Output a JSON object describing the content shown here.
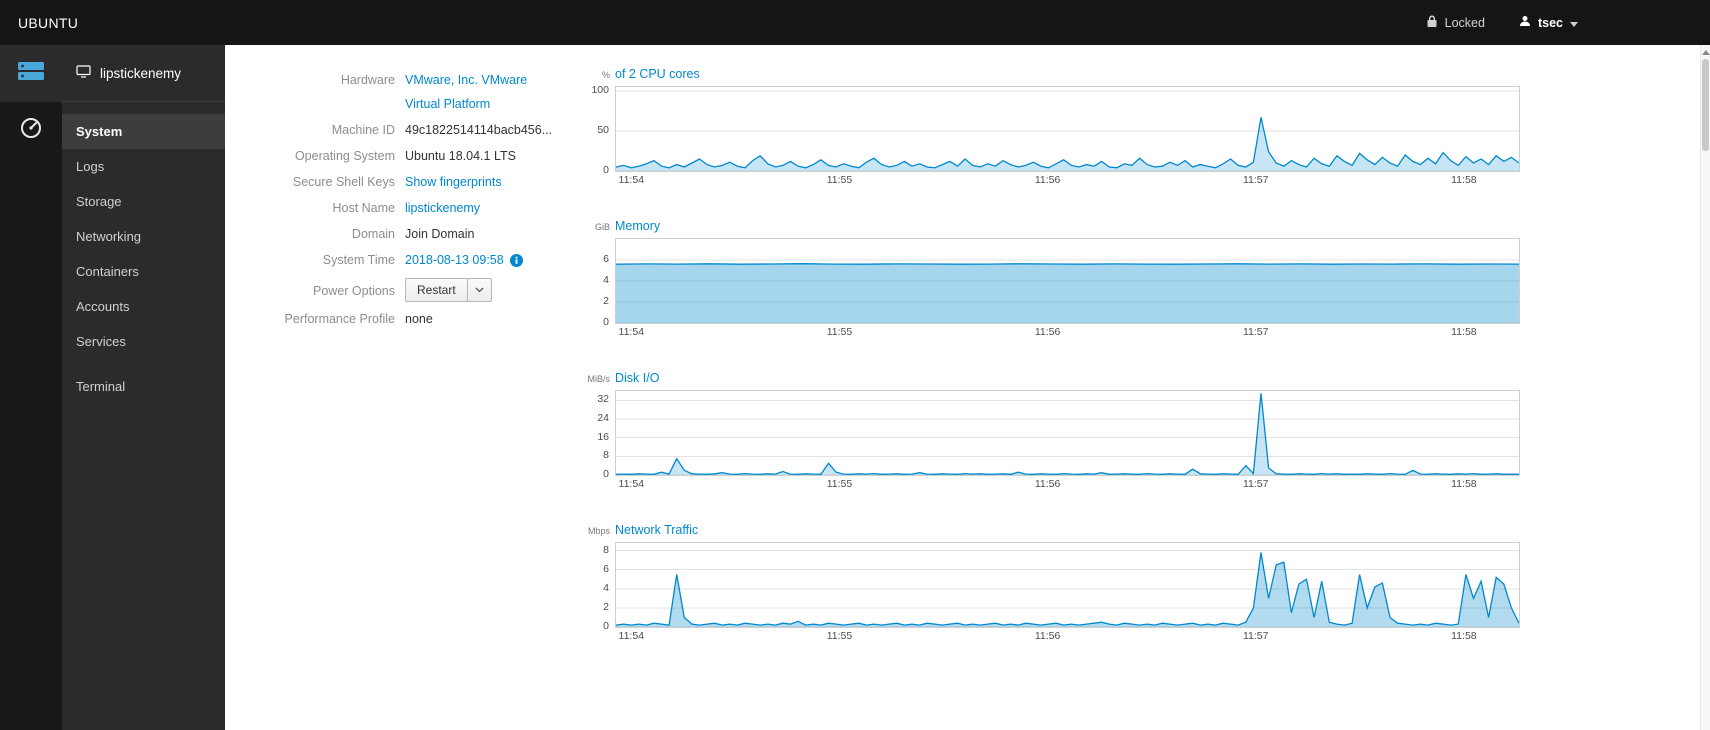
{
  "topbar": {
    "brand": "UBUNTU",
    "locked_label": "Locked",
    "user": "tsec"
  },
  "sidebar": {
    "host": "lipstickenemy",
    "items": [
      {
        "label": "System"
      },
      {
        "label": "Logs"
      },
      {
        "label": "Storage"
      },
      {
        "label": "Networking"
      },
      {
        "label": "Containers"
      },
      {
        "label": "Accounts"
      },
      {
        "label": "Services"
      },
      {
        "label": "Terminal"
      }
    ]
  },
  "system": {
    "hardware_label": "Hardware",
    "hardware_value_line1": "VMware, Inc. VMware",
    "hardware_value_line2": "Virtual Platform",
    "machine_id_label": "Machine ID",
    "machine_id_value": "49c1822514114bacb456...",
    "os_label": "Operating System",
    "os_value": "Ubuntu 18.04.1 LTS",
    "ssh_label": "Secure Shell Keys",
    "ssh_value": "Show fingerprints",
    "hostname_label": "Host Name",
    "hostname_value": "lipstickenemy",
    "domain_label": "Domain",
    "domain_value": "Join Domain",
    "time_label": "System Time",
    "time_value": "2018-08-13 09:58",
    "power_label": "Power Options",
    "power_button": "Restart",
    "profile_label": "Performance Profile",
    "profile_value": "none"
  },
  "colors": {
    "accent": "#0088ce",
    "link": "#0088ce",
    "nav_bg": "#2b2b2b",
    "topbar_bg": "#151515"
  },
  "chart_data": [
    {
      "type": "area",
      "unit": "%",
      "title": "of 2 CPU cores",
      "ylim": [
        0,
        105
      ],
      "yticks": [
        0,
        50,
        100
      ],
      "xticks": [
        "11:54",
        "11:55",
        "11:56",
        "11:57",
        "11:58"
      ],
      "xtick_pos": [
        0.018,
        0.248,
        0.478,
        0.708,
        0.938
      ],
      "line_color": "#0088ce",
      "fill_opacity": 0.22,
      "values": [
        5,
        7,
        4,
        6,
        9,
        13,
        6,
        4,
        8,
        5,
        10,
        15,
        8,
        5,
        7,
        11,
        6,
        4,
        13,
        19,
        9,
        5,
        7,
        12,
        6,
        4,
        8,
        14,
        7,
        5,
        9,
        6,
        4,
        11,
        16,
        8,
        5,
        7,
        12,
        6,
        9,
        5,
        4,
        8,
        12,
        6,
        15,
        7,
        5,
        9,
        6,
        13,
        8,
        5,
        7,
        11,
        6,
        4,
        9,
        14,
        7,
        5,
        8,
        6,
        12,
        5,
        4,
        9,
        7,
        16,
        8,
        5,
        6,
        11,
        7,
        13,
        5,
        8,
        6,
        4,
        9,
        15,
        7,
        5,
        11,
        67,
        24,
        10,
        6,
        13,
        8,
        5,
        16,
        9,
        6,
        19,
        12,
        7,
        22,
        14,
        8,
        17,
        10,
        6,
        20,
        12,
        8,
        16,
        9,
        23,
        13,
        7,
        18,
        10,
        15,
        8,
        19,
        12,
        17,
        10
      ]
    },
    {
      "type": "area",
      "unit": "GiB",
      "title": "Memory",
      "ylim": [
        0,
        8
      ],
      "yticks": [
        0,
        2,
        4,
        6
      ],
      "xticks": [
        "11:54",
        "11:55",
        "11:56",
        "11:57",
        "11:58"
      ],
      "xtick_pos": [
        0.018,
        0.248,
        0.478,
        0.708,
        0.938
      ],
      "line_color": "#0088ce",
      "fill_opacity": 0.35,
      "values": [
        5.6,
        5.63,
        5.61,
        5.64,
        5.6,
        5.62,
        5.65,
        5.61,
        5.6,
        5.63,
        5.62,
        5.6,
        5.61,
        5.64,
        5.62,
        5.6,
        5.63,
        5.61,
        5.6,
        5.62,
        5.64,
        5.61,
        5.63,
        5.6,
        5.62,
        5.61,
        5.63,
        5.6,
        5.62,
        5.61
      ]
    },
    {
      "type": "area",
      "unit": "MiB/s",
      "title": "Disk I/O",
      "ylim": [
        0,
        36
      ],
      "yticks": [
        0,
        8,
        16,
        24,
        32
      ],
      "xticks": [
        "11:54",
        "11:55",
        "11:56",
        "11:57",
        "11:58"
      ],
      "xtick_pos": [
        0.018,
        0.248,
        0.478,
        0.708,
        0.938
      ],
      "line_color": "#0088ce",
      "fill_opacity": 0.22,
      "values": [
        0.3,
        0.4,
        0.3,
        0.5,
        0.4,
        0.3,
        1.2,
        0.4,
        7,
        2,
        0.5,
        0.4,
        0.3,
        0.5,
        1,
        0.4,
        0.3,
        0.6,
        0.4,
        0.3,
        0.5,
        0.4,
        1.5,
        0.4,
        0.3,
        0.5,
        0.4,
        0.3,
        5,
        1.2,
        0.4,
        0.3,
        0.5,
        0.4,
        0.6,
        0.3,
        0.4,
        0.5,
        0.3,
        0.4,
        1,
        0.4,
        0.3,
        0.5,
        0.4,
        0.3,
        0.6,
        0.4,
        0.5,
        0.3,
        0.4,
        0.5,
        0.3,
        1.2,
        0.4,
        0.3,
        0.5,
        0.4,
        0.3,
        0.6,
        0.4,
        0.3,
        0.5,
        0.4,
        1,
        0.3,
        0.4,
        0.5,
        0.4,
        0.3,
        0.6,
        0.4,
        0.3,
        0.5,
        0.4,
        0.3,
        2.5,
        0.5,
        0.4,
        0.3,
        0.5,
        0.4,
        0.3,
        4,
        0.6,
        35,
        3,
        0.5,
        0.4,
        0.3,
        0.5,
        0.4,
        0.3,
        0.6,
        0.4,
        0.5,
        0.3,
        0.4,
        0.3,
        0.5,
        0.4,
        0.3,
        0.6,
        0.4,
        0.3,
        2,
        0.4,
        0.3,
        0.5,
        0.4,
        0.3,
        0.5,
        0.4,
        0.6,
        0.3,
        0.4,
        0.5,
        0.3,
        0.4,
        0.3
      ]
    },
    {
      "type": "area",
      "unit": "Mbps",
      "title": "Network Traffic",
      "ylim": [
        0,
        8.8
      ],
      "yticks": [
        0,
        2,
        4,
        6,
        8
      ],
      "xticks": [
        "11:54",
        "11:55",
        "11:56",
        "11:57",
        "11:58"
      ],
      "xtick_pos": [
        0.018,
        0.248,
        0.478,
        0.708,
        0.938
      ],
      "line_color": "#0088ce",
      "fill_opacity": 0.3,
      "values": [
        0.2,
        0.3,
        0.2,
        0.3,
        0.2,
        0.4,
        0.3,
        0.2,
        5.5,
        1,
        0.3,
        0.2,
        0.3,
        0.4,
        0.2,
        0.3,
        0.2,
        0.4,
        0.3,
        0.2,
        0.3,
        0.2,
        0.4,
        0.3,
        0.6,
        0.2,
        0.3,
        0.2,
        0.4,
        0.3,
        0.2,
        0.3,
        0.4,
        0.2,
        0.3,
        0.2,
        0.3,
        0.4,
        0.2,
        0.3,
        0.2,
        0.4,
        0.3,
        0.2,
        0.3,
        0.4,
        0.2,
        0.3,
        0.2,
        0.3,
        0.4,
        0.2,
        0.3,
        0.2,
        0.4,
        0.3,
        0.2,
        0.3,
        0.4,
        0.2,
        0.3,
        0.2,
        0.3,
        0.4,
        0.5,
        0.3,
        0.2,
        0.4,
        0.3,
        0.2,
        0.3,
        0.2,
        0.4,
        0.3,
        0.2,
        0.3,
        0.4,
        0.2,
        0.3,
        0.2,
        0.4,
        0.3,
        0.2,
        0.5,
        2,
        7.8,
        3,
        6.5,
        6.8,
        1.5,
        4.5,
        5,
        1,
        4.8,
        0.5,
        0.3,
        0.2,
        0.4,
        5.5,
        2,
        4.2,
        4.6,
        1,
        0.4,
        0.3,
        0.2,
        0.3,
        0.2,
        0.4,
        0.3,
        0.2,
        0.3,
        5.5,
        3,
        4.8,
        1,
        5.2,
        4.5,
        2,
        0.4
      ]
    }
  ]
}
